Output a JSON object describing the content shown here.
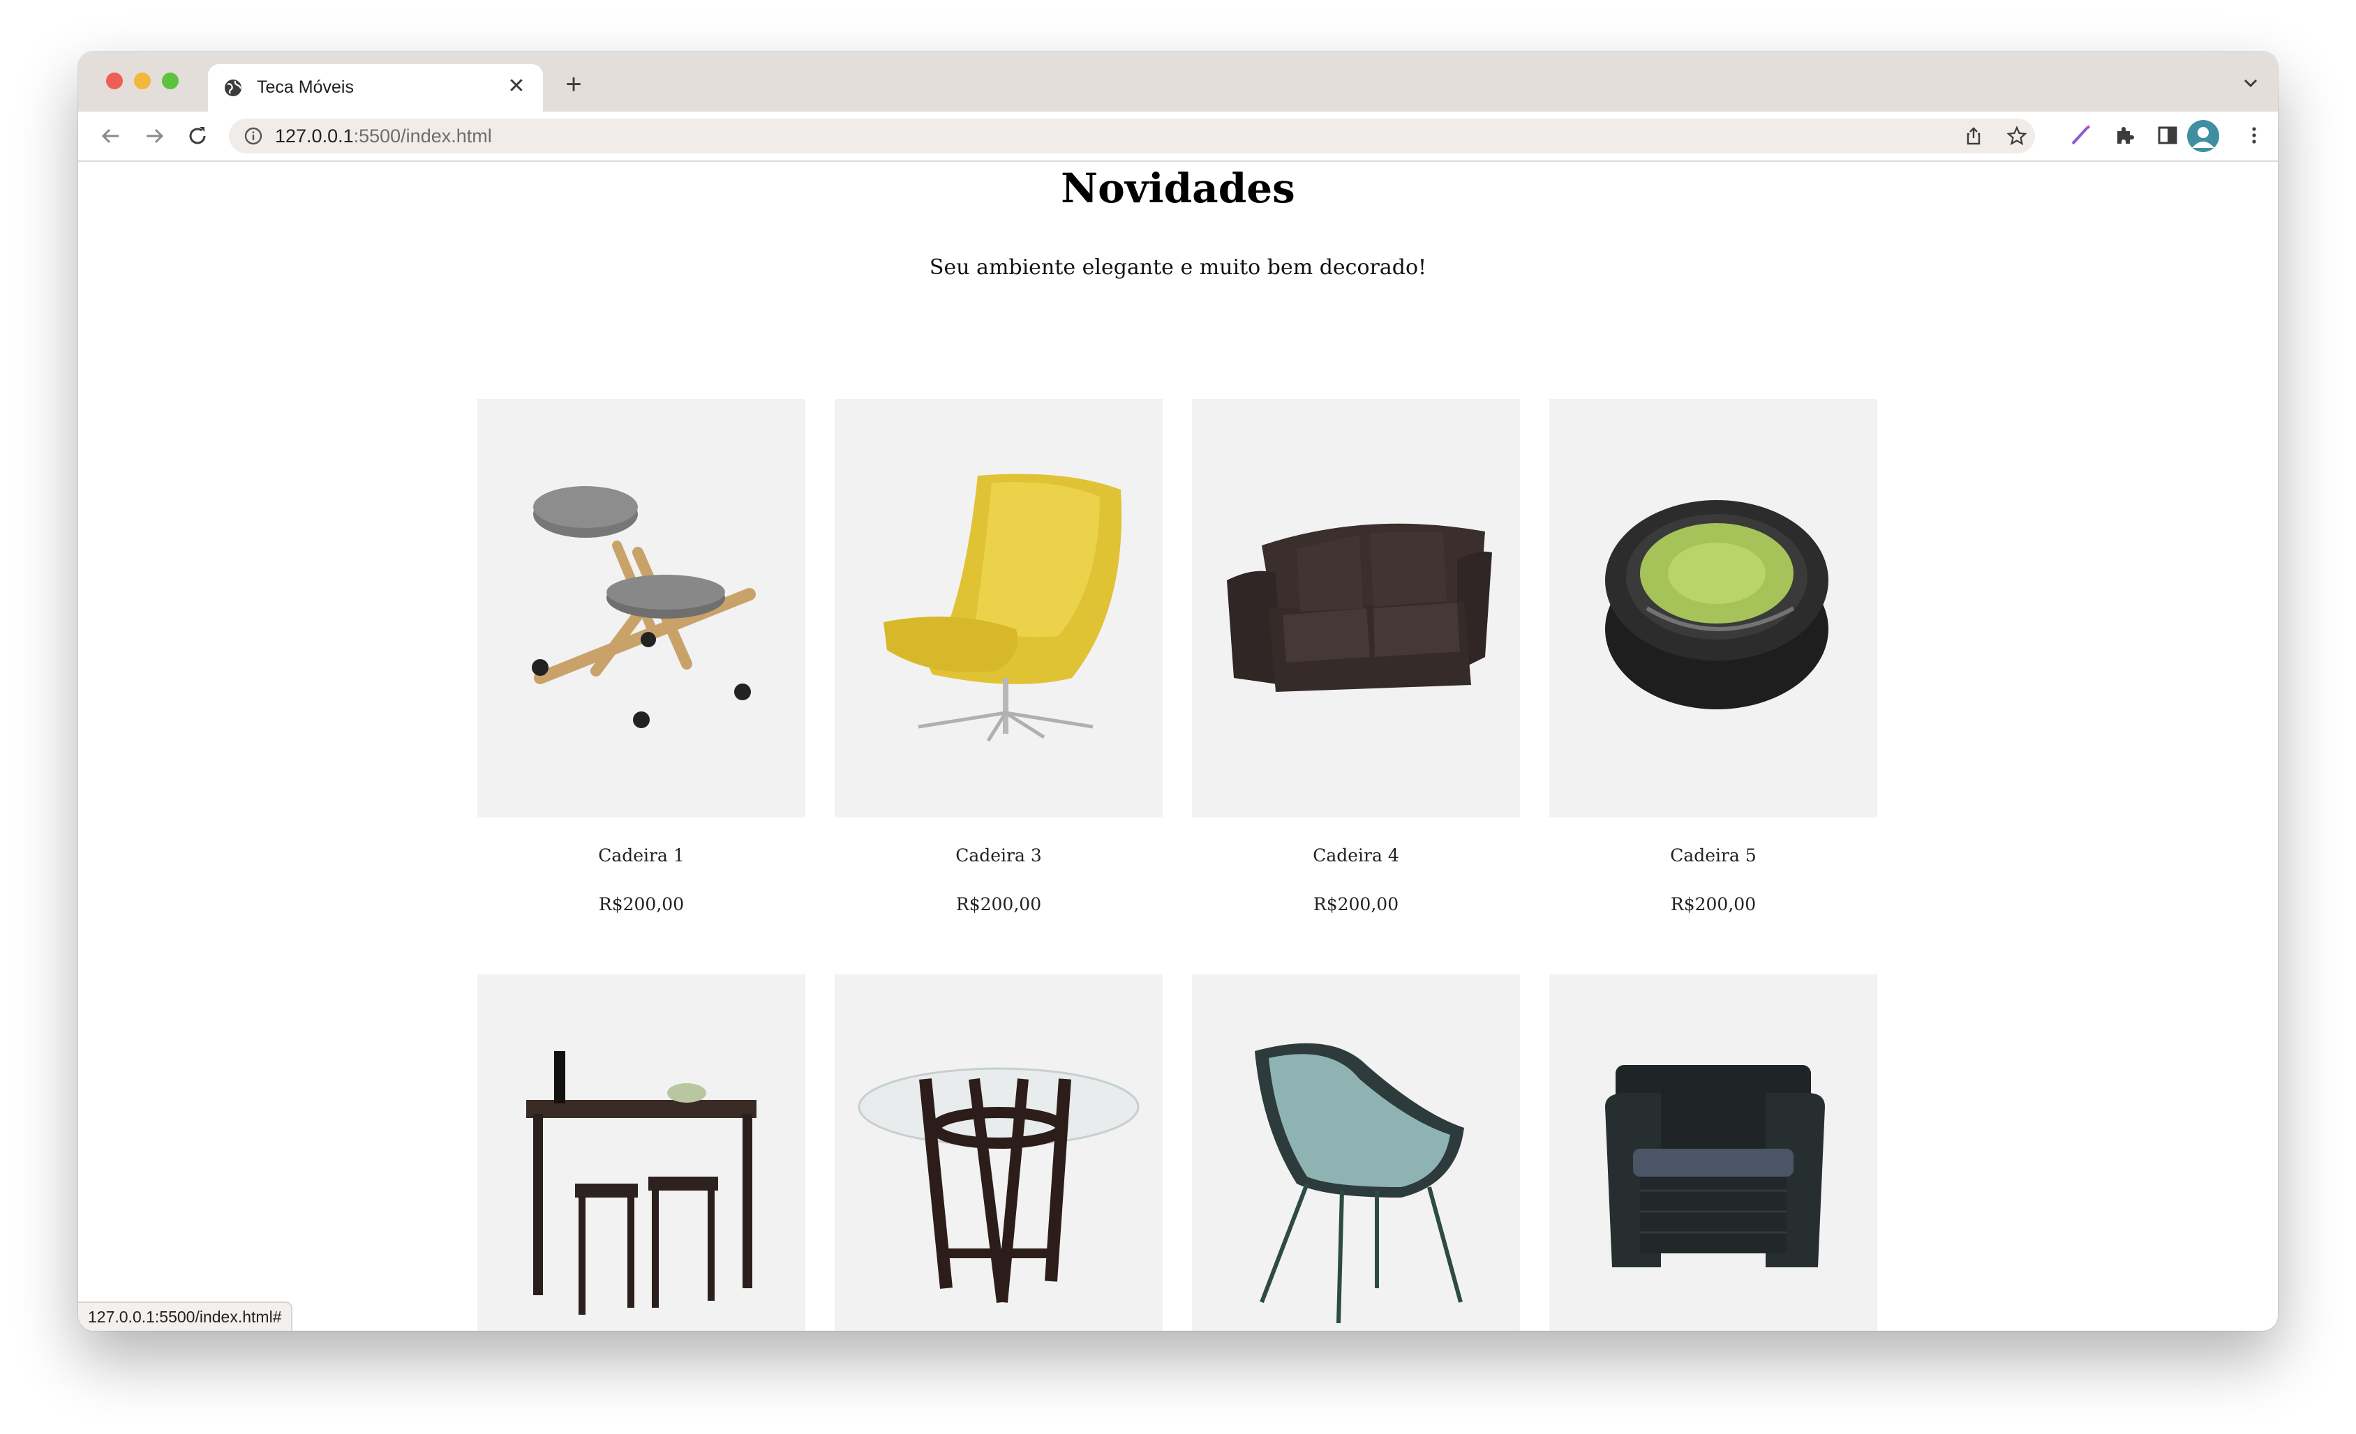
{
  "browser": {
    "tab_title": "Teca Móveis",
    "url_host": "127.0.0.1",
    "url_rest": ":5500/index.html",
    "status_url": "127.0.0.1:5500/index.html#"
  },
  "page": {
    "heading": "Novidades",
    "subheading": "Seu ambiente elegante e muito bem decorado!"
  },
  "products": [
    {
      "name": "Cadeira 1",
      "price": "R$200,00",
      "image": "kneeling-chair-image"
    },
    {
      "name": "Cadeira 3",
      "price": "R$200,00",
      "image": "yellow-lounge-chair-image"
    },
    {
      "name": "Cadeira 4",
      "price": "R$200,00",
      "image": "leather-loveseat-image"
    },
    {
      "name": "Cadeira 5",
      "price": "R$200,00",
      "image": "inflatable-chair-image"
    },
    {
      "image": "bar-table-stools-image"
    },
    {
      "image": "glass-round-table-image"
    },
    {
      "image": "teal-shell-chair-image"
    },
    {
      "image": "wicker-armchair-image"
    }
  ],
  "colors": {
    "tabstrip": "#e4dedb",
    "card_bg": "#f2f2f2",
    "close": "#ee5e55",
    "minimize": "#f3b73c",
    "zoom": "#5cc33e"
  }
}
